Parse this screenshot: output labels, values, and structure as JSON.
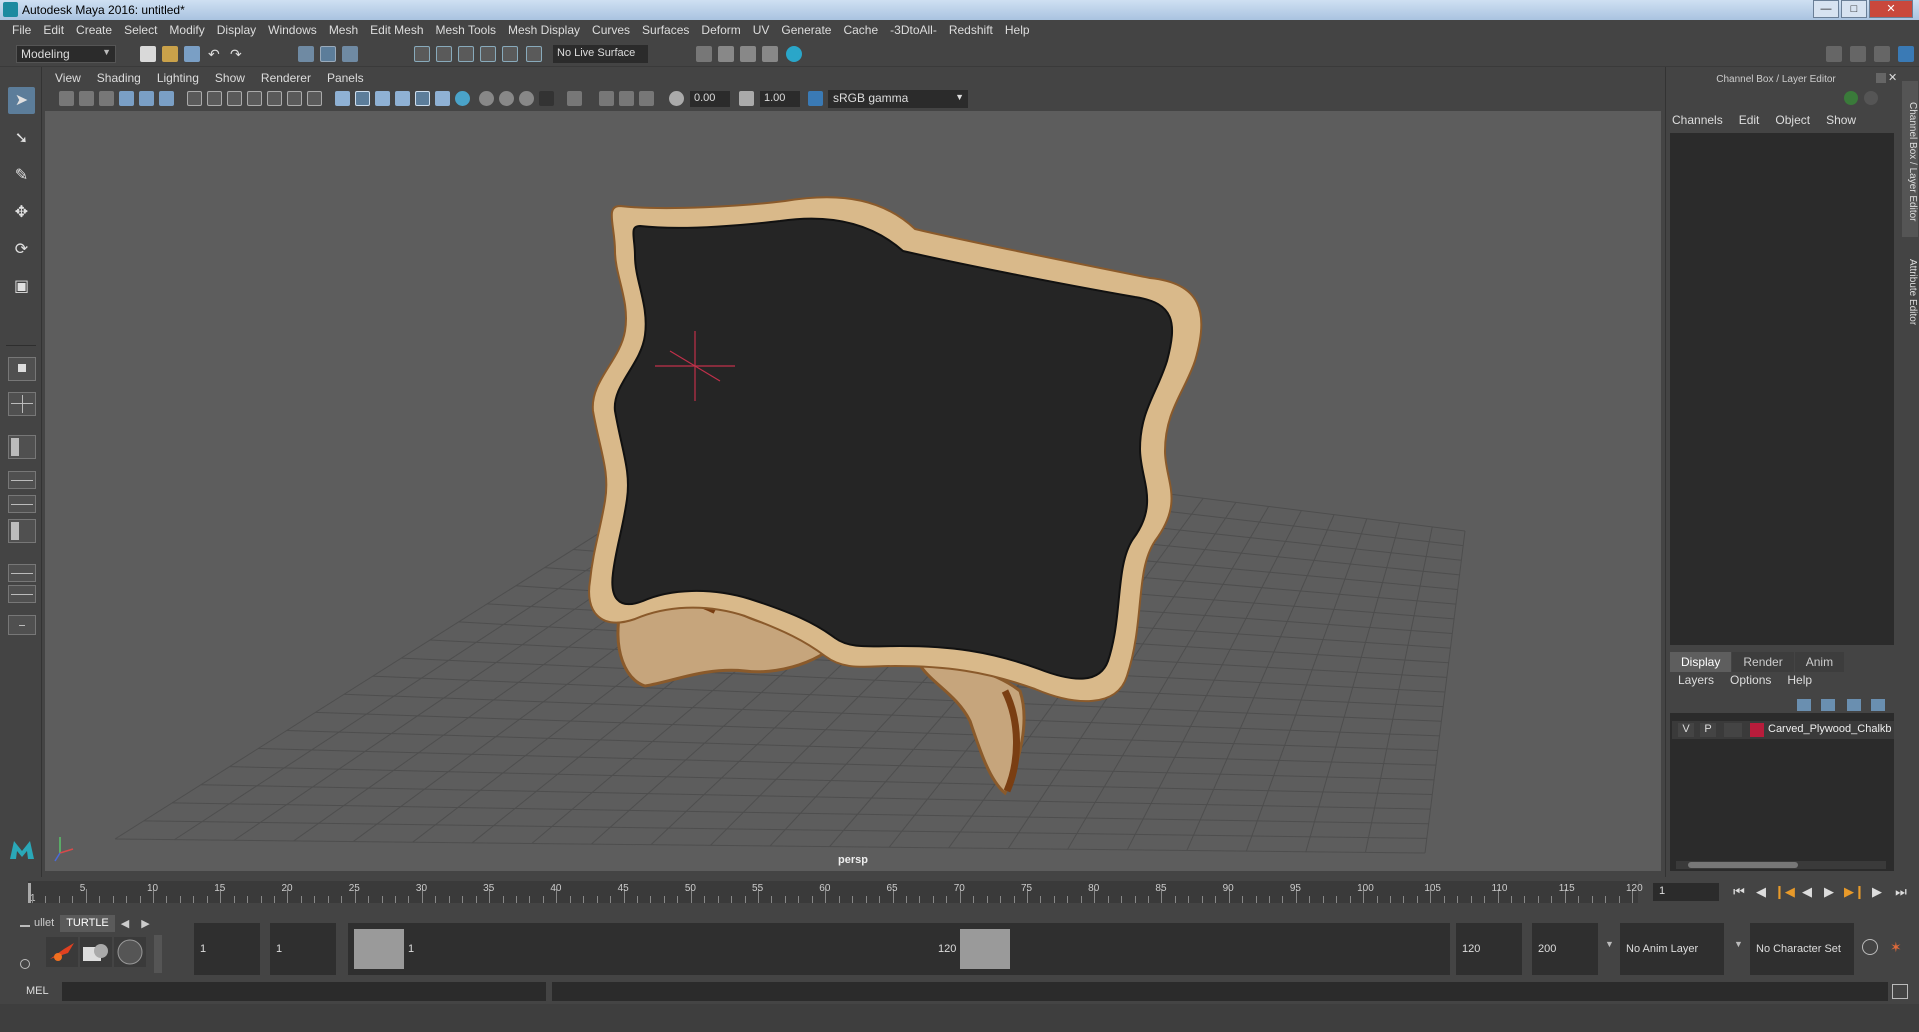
{
  "window": {
    "title": "Autodesk Maya 2016: untitled*"
  },
  "menubar": [
    "File",
    "Edit",
    "Create",
    "Select",
    "Modify",
    "Display",
    "Windows",
    "Mesh",
    "Edit Mesh",
    "Mesh Tools",
    "Mesh Display",
    "Curves",
    "Surfaces",
    "Deform",
    "UV",
    "Generate",
    "Cache",
    "-3DtoAll-",
    "Redshift",
    "Help"
  ],
  "statusline": {
    "mode": "Modeling",
    "live_surface": "No Live Surface"
  },
  "panel": {
    "menus": [
      "View",
      "Shading",
      "Lighting",
      "Show",
      "Renderer",
      "Panels"
    ],
    "exposure": "0.00",
    "gamma": "1.00",
    "color_space": "sRGB gamma",
    "camera_label": "persp"
  },
  "channel_box": {
    "title": "Channel Box / Layer Editor",
    "menus": [
      "Channels",
      "Edit",
      "Object",
      "Show"
    ],
    "side_tabs": [
      "Channel Box / Layer Editor",
      "Attribute Editor"
    ]
  },
  "layer_editor": {
    "tabs": [
      "Display",
      "Render",
      "Anim"
    ],
    "active_tab": "Display",
    "menus": [
      "Layers",
      "Options",
      "Help"
    ],
    "layers": [
      {
        "v": "V",
        "p": "P",
        "color": "#b81c3b",
        "name": "Carved_Plywood_Chalkb"
      }
    ]
  },
  "timeline": {
    "tick_labels": [
      "5",
      "10",
      "15",
      "20",
      "25",
      "30",
      "35",
      "40",
      "45",
      "50",
      "55",
      "60",
      "65",
      "70",
      "75",
      "80",
      "85",
      "90",
      "95",
      "100",
      "105",
      "110",
      "115",
      "120"
    ],
    "start_label": "1",
    "current_frame": "1"
  },
  "range": {
    "start": "1",
    "anim_start": "1",
    "slider_start_label": "1",
    "slider_end_label": "120",
    "end": "120",
    "anim_end": "200",
    "anim_layer": "No Anim Layer",
    "character_set": "No Character Set"
  },
  "shelf": {
    "tabs": [
      "ullet",
      "TURTLE"
    ],
    "active": "TURTLE"
  },
  "command_line": {
    "label": "MEL"
  }
}
